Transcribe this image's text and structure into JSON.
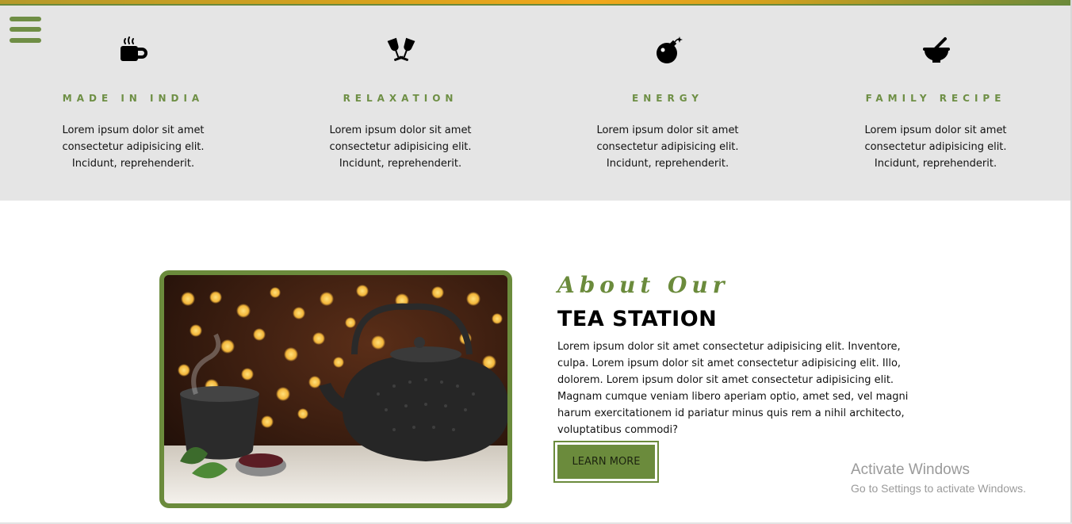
{
  "menu": {
    "icon": "hamburger-menu-icon"
  },
  "features": [
    {
      "icon": "coffee-cup-icon",
      "title": "MADE IN INDIA",
      "description": "Lorem ipsum dolor sit amet consectetur adipisicing elit. Incidunt, reprehenderit."
    },
    {
      "icon": "glasses-cheers-icon",
      "title": "RELAXATION",
      "description": "Lorem ipsum dolor sit amet consectetur adipisicing elit. Incidunt, reprehenderit."
    },
    {
      "icon": "bomb-icon",
      "title": "ENERGY",
      "description": "Lorem ipsum dolor sit amet consectetur adipisicing elit. Incidunt, reprehenderit."
    },
    {
      "icon": "mortar-pestle-icon",
      "title": "FAMILY RECIPE",
      "description": "Lorem ipsum dolor sit amet consectetur adipisicing elit. Incidunt, reprehenderit."
    }
  ],
  "about": {
    "kicker": "About Our",
    "title": "TEA STATION",
    "text": "Lorem ipsum dolor sit amet consectetur adipisicing elit. Inventore, culpa. Lorem ipsum dolor sit amet consectetur adipisicing elit. Illo, dolorem. Lorem ipsum dolor sit amet consectetur adipisicing elit. Magnam cumque veniam libero aperiam optio, amet sed, vel magni harum exercitationem id pariatur minus quis rem a nihil architecto, voluptatibus commodi?",
    "button_label": "LEARN MORE",
    "image": "teapot-photo"
  },
  "watermark": {
    "line1": "Activate Windows",
    "line2": "Go to Settings to activate Windows."
  },
  "colors": {
    "accent": "#6b8b3c",
    "section_bg": "#e5e5e5",
    "top_strip": "#f2a81b"
  }
}
